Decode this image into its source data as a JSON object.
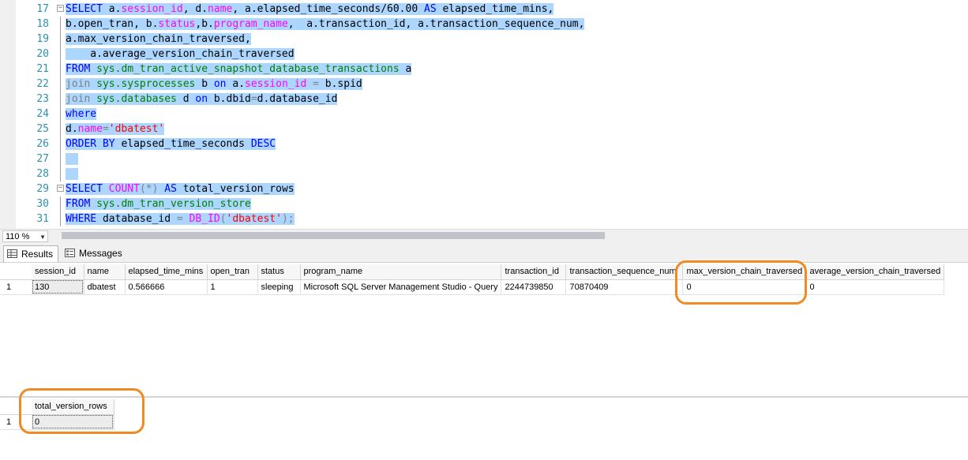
{
  "editor": {
    "lines": [
      {
        "n": "17",
        "fold": "minus",
        "segs": [
          [
            "kw",
            "SELECT "
          ],
          [
            "bl",
            "a."
          ],
          [
            "fn",
            "session_id"
          ],
          [
            "bl",
            ", d."
          ],
          [
            "fn",
            "name"
          ],
          [
            "bl",
            ", a.elapsed_time_seconds/60.00 "
          ],
          [
            "kw",
            "AS"
          ],
          [
            "bl",
            " elapsed_time_mins,"
          ]
        ]
      },
      {
        "n": "18",
        "fold": "line",
        "segs": [
          [
            "bl",
            "b.open_tran, b."
          ],
          [
            "fn",
            "status"
          ],
          [
            "bl",
            ",b."
          ],
          [
            "fn",
            "program_name"
          ],
          [
            "bl",
            ",  a.transaction_id, a.transaction_sequence_num,"
          ]
        ]
      },
      {
        "n": "19",
        "fold": "line",
        "segs": [
          [
            "bl",
            "a.max_version_chain_traversed,"
          ]
        ]
      },
      {
        "n": "20",
        "fold": "line",
        "segs": [
          [
            "bl",
            "    a.average_version_chain_traversed"
          ]
        ]
      },
      {
        "n": "21",
        "fold": "line",
        "segs": [
          [
            "kw",
            "FROM "
          ],
          [
            "sys",
            "sys.dm_tran_active_snapshot_database_transactions"
          ],
          [
            "bl",
            " a"
          ]
        ]
      },
      {
        "n": "22",
        "fold": "line",
        "segs": [
          [
            "gray",
            "join "
          ],
          [
            "sys",
            "sys.sysprocesses"
          ],
          [
            "bl",
            " b "
          ],
          [
            "kw",
            "on"
          ],
          [
            "bl",
            " a."
          ],
          [
            "fn",
            "session_id"
          ],
          [
            "gray",
            " = "
          ],
          [
            "bl",
            "b.spid"
          ]
        ]
      },
      {
        "n": "23",
        "fold": "line",
        "segs": [
          [
            "gray",
            "join "
          ],
          [
            "sys",
            "sys.databases"
          ],
          [
            "bl",
            " d "
          ],
          [
            "kw",
            "on"
          ],
          [
            "bl",
            " b.dbid"
          ],
          [
            "gray",
            "="
          ],
          [
            "bl",
            "d.database_id"
          ]
        ]
      },
      {
        "n": "24",
        "fold": "line",
        "segs": [
          [
            "kw",
            "where"
          ]
        ]
      },
      {
        "n": "25",
        "fold": "line",
        "segs": [
          [
            "bl",
            "d."
          ],
          [
            "fn",
            "name"
          ],
          [
            "gray",
            "="
          ],
          [
            "str",
            "'dbatest'"
          ]
        ]
      },
      {
        "n": "26",
        "fold": "line",
        "segs": [
          [
            "kw",
            "ORDER BY"
          ],
          [
            "bl",
            " elapsed_time_seconds "
          ],
          [
            "kw",
            "DESC"
          ]
        ]
      },
      {
        "n": "27",
        "fold": "line",
        "segs": [
          [
            "bl",
            "  "
          ]
        ]
      },
      {
        "n": "28",
        "fold": "line",
        "segs": [
          [
            "bl",
            "  "
          ]
        ]
      },
      {
        "n": "29",
        "fold": "minus",
        "segs": [
          [
            "kw",
            "SELECT "
          ],
          [
            "fn",
            "COUNT"
          ],
          [
            "gray",
            "(*)"
          ],
          [
            "kw",
            " AS"
          ],
          [
            "bl",
            " total_version_rows"
          ]
        ]
      },
      {
        "n": "30",
        "fold": "line",
        "segs": [
          [
            "kw",
            "FROM "
          ],
          [
            "sys",
            "sys.dm_tran_version_store"
          ]
        ]
      },
      {
        "n": "31",
        "fold": "line",
        "segs": [
          [
            "kw",
            "WHERE"
          ],
          [
            "bl",
            " database_id "
          ],
          [
            "gray",
            "="
          ],
          [
            "fn",
            " DB_ID"
          ],
          [
            "gray",
            "("
          ],
          [
            "str",
            "'dbatest'"
          ],
          [
            "gray",
            ");"
          ]
        ]
      }
    ],
    "partial_line_number": "32"
  },
  "zoom": {
    "value": "110 %"
  },
  "tabs": {
    "results": "Results",
    "messages": "Messages"
  },
  "grid1": {
    "headers": [
      "session_id",
      "name",
      "elapsed_time_mins",
      "open_tran",
      "status",
      "program_name",
      "transaction_id",
      "transaction_sequence_num",
      "max_version_chain_traversed",
      "average_version_chain_traversed"
    ],
    "rows": [
      {
        "num": "1",
        "cells": [
          "130",
          "dbatest",
          "0.566666",
          "1",
          "sleeping",
          "Microsoft SQL Server Management Studio - Query",
          "2244739850",
          "70870409",
          "0",
          "0"
        ]
      }
    ]
  },
  "grid2": {
    "headers": [
      "total_version_rows"
    ],
    "rows": [
      {
        "num": "1",
        "cells": [
          "0"
        ]
      }
    ]
  },
  "colors": {
    "highlight": "#f08a24",
    "selection": "#add6ff"
  }
}
